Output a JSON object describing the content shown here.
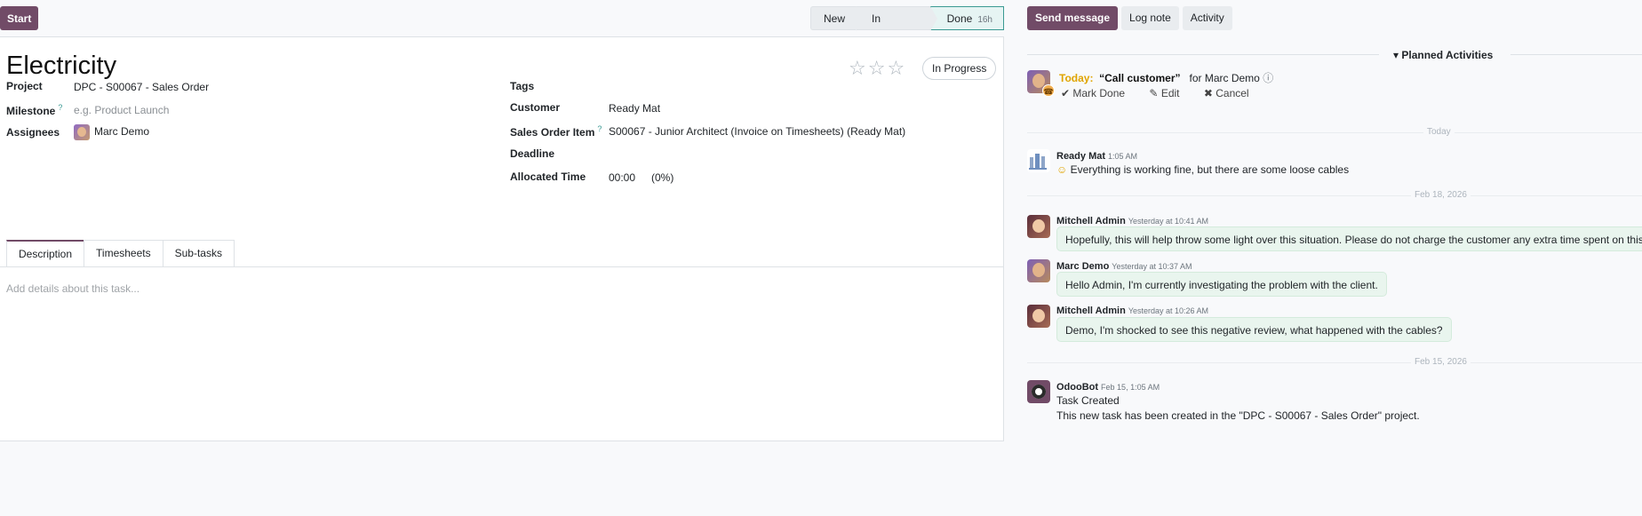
{
  "toolbar": {
    "start_label": "Start",
    "stages": [
      {
        "label": "New"
      },
      {
        "label": "In Progress"
      },
      {
        "label": "Done",
        "hours": "16h"
      }
    ]
  },
  "form": {
    "title": "Electricity",
    "state": "In Progress",
    "rating_stars": 3,
    "fields_left": {
      "project": {
        "label": "Project",
        "value": "DPC - S00067 - Sales Order"
      },
      "milestone": {
        "label": "Milestone",
        "placeholder": "e.g. Product Launch",
        "help": "?"
      },
      "assignees": {
        "label": "Assignees",
        "value": "Marc Demo"
      }
    },
    "fields_right": {
      "tags": {
        "label": "Tags",
        "value": ""
      },
      "customer": {
        "label": "Customer",
        "value": "Ready Mat"
      },
      "sales_order_item": {
        "label": "Sales Order Item",
        "help": "?",
        "value": "S00067 - Junior Architect (Invoice on Timesheets) (Ready Mat)"
      },
      "deadline": {
        "label": "Deadline",
        "value": ""
      },
      "allocated_time": {
        "label": "Allocated Time",
        "value": "00:00",
        "percent": "(0%)"
      }
    },
    "tabs": [
      "Description",
      "Timesheets",
      "Sub-tasks"
    ],
    "description_placeholder": "Add details about this task..."
  },
  "chatter": {
    "buttons": {
      "send": "Send message",
      "log": "Log note",
      "activity": "Activity"
    },
    "planned_activities_label": "Planned Activities",
    "activity": {
      "when": "Today:",
      "summary": "“Call customer”",
      "for": "for Marc Demo",
      "actions": {
        "done": "Mark Done",
        "edit": "Edit",
        "cancel": "Cancel"
      }
    },
    "dates": {
      "today": "Today",
      "feb18": "Feb 18, 2026",
      "feb15": "Feb 15, 2026"
    },
    "messages": [
      {
        "author": "Ready Mat",
        "time": "1:05 AM",
        "body": "Everything is working fine, but there are some loose cables"
      },
      {
        "author": "Mitchell Admin",
        "time": "Yesterday at 10:41 AM",
        "body": "Hopefully, this will help throw some light over this situation. Please do not charge the customer any extra time spent on this."
      },
      {
        "author": "Marc Demo",
        "time": "Yesterday at 10:37 AM",
        "body": "Hello Admin, I'm currently investigating the problem with the client."
      },
      {
        "author": "Mitchell Admin",
        "time": "Yesterday at 10:26 AM",
        "body": "Demo, I'm shocked to see this negative review, what happened with the cables?"
      },
      {
        "author": "OdooBot",
        "time": "Feb 15, 1:05 AM",
        "title": "Task Created",
        "body": "This new task has been created in the \"DPC - S00067 - Sales Order\" project."
      }
    ]
  }
}
